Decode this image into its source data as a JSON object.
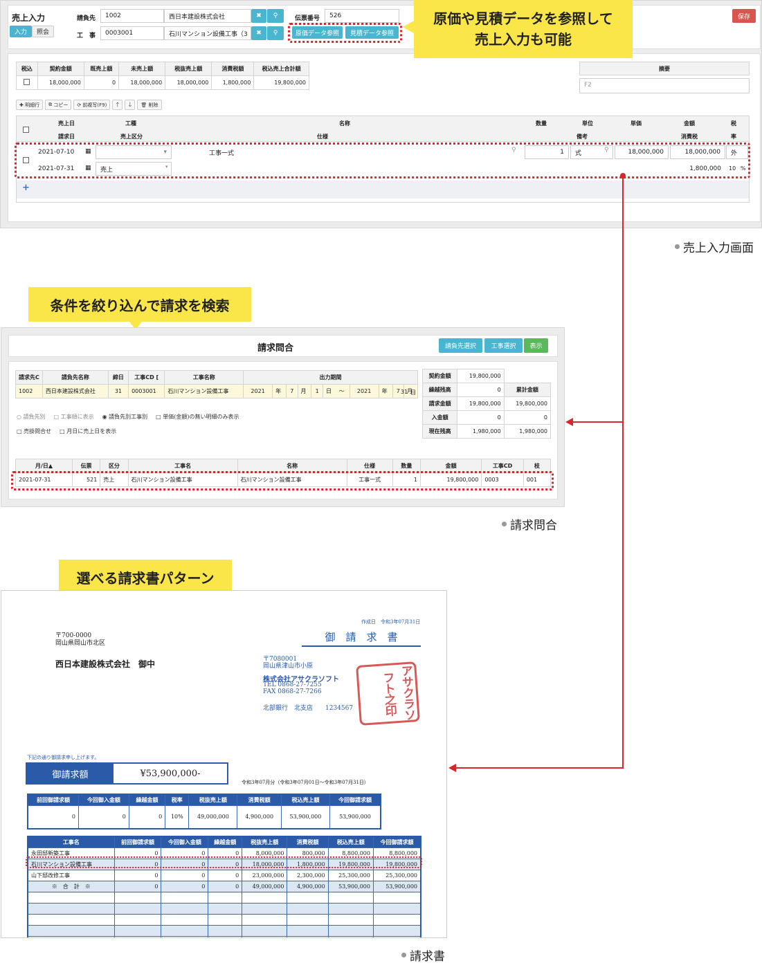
{
  "colors": {
    "callout": "#fbe64a",
    "red": "#d8262d",
    "teal": "#4ab5cf",
    "green": "#5cb85c",
    "save": "#d9534f",
    "blue": "#2a5aa8"
  },
  "sales": {
    "title": "売上入力",
    "tab_input": "入力",
    "tab_ref": "照会",
    "customer_label": "請負先",
    "customer_code": "1002",
    "customer_name": "西日本建設株式会社",
    "work_label": "工　事",
    "work_code": "0003001",
    "work_name": "石川マンション設備工事（3",
    "slip_label": "伝票番号",
    "slip_no": "526",
    "btn_cost": "原価データ参照",
    "btn_estimate": "見積データ参照",
    "save": "保存",
    "summary_headers": [
      "税込",
      "契約金額",
      "既売上額",
      "未売上額",
      "税抜売上額",
      "消費税額",
      "税込売上合計額"
    ],
    "summary_values": [
      "18,000,000",
      "0",
      "18,000,000",
      "18,000,000",
      "1,800,000",
      "19,800,000"
    ],
    "memo_label": "摘要",
    "memo_placeholder": "F2",
    "toolbar": [
      "明細行",
      "コピー",
      "前複写(F9)",
      "削除"
    ],
    "grid_h1": [
      "売上日",
      "工種",
      "名称",
      "数量",
      "単位",
      "単価",
      "金額",
      "税"
    ],
    "grid_h2": [
      "請求日",
      "売上区分",
      "仕様",
      "備考",
      "消費税",
      "率"
    ],
    "row1": {
      "date": "2021-07-10",
      "name": "工事一式",
      "qty": "1",
      "unit": "式",
      "price": "18,000,000",
      "amount": "18,000,000",
      "tax": "外"
    },
    "row2": {
      "date": "2021-07-31",
      "kubun": "売上",
      "tax_amount": "1,800,000",
      "rate": "10",
      "pct": "%"
    },
    "add": "+"
  },
  "callout1": {
    "line1": "原価や見積データを参照して",
    "line2": "売上入力も可能"
  },
  "caption1": "売上入力画面",
  "callout2": "条件を絞り込んで請求を検索",
  "inquiry": {
    "title": "請求問合",
    "btn_customer": "請負先選択",
    "btn_work": "工事選択",
    "btn_show": "表示",
    "cond_headers": [
      "請求先C",
      "請負先名称",
      "締日",
      "工事CD [",
      "工事名称",
      "出力期間"
    ],
    "cond_values": {
      "code": "1002",
      "name": "西日本建設株式会社",
      "close": "31",
      "work_cd": "0003001",
      "work_name": "石川マンション設備工事",
      "y1": "2021",
      "m1": "7",
      "d1": "1",
      "y2": "2021",
      "m2": "7",
      "d2": "31",
      "year": "年",
      "month": "月",
      "day": "日",
      "tilde": "〜"
    },
    "options": [
      "請負先別",
      "工事順に表示",
      "請負先別工事別",
      "単価(金額)の無い明細のみ表示",
      "売掛問合せ",
      "月日に売上日を表示"
    ],
    "side": {
      "contract_label": "契約金額",
      "contract": "19,800,000",
      "carry_label": "繰越残高",
      "carry": "0",
      "cum_label": "累計金額",
      "bill_label": "請求金額",
      "bill": "19,800,000",
      "bill_cum": "19,800,000",
      "recv_label": "入金額",
      "recv": "0",
      "recv_cum": "0",
      "bal_label": "現在残高",
      "bal": "1,980,000",
      "bal_cum": "1,980,000"
    },
    "list_headers": [
      "月/日▲",
      "伝票",
      "区分",
      "工事名",
      "名称",
      "仕様",
      "数量",
      "金額",
      "工事CD",
      "枝"
    ],
    "list_row": [
      "2021-07-31",
      "521",
      "売上",
      "石川マンション設備工事",
      "石川マンション設備工事",
      "工事一式",
      "1",
      "19,800,000",
      "0003",
      "001"
    ]
  },
  "caption2": "請求問合",
  "callout3": "選べる請求書パターン",
  "invoice": {
    "created": "作成日　令和3年07月31日",
    "title": "御　請　求　書",
    "to_zip": "〒700-0000",
    "to_addr": "岡山県岡山市北区",
    "to_name": "西日本建設株式会社　御中",
    "from_zip": "〒7080001",
    "from_addr": "岡山県津山市小原",
    "from_company": "株式会社アサクラソフト",
    "tel": "TEL 0868-27-7255",
    "fax": "FAX 0868-27-7266",
    "bank": "北部銀行　北支店　　1234567",
    "stamp": "アサクラソフト之印",
    "lead": "下記の通り御請求申し上げます。",
    "amount_label": "御請求額",
    "amount": "¥53,900,000-",
    "period": "令和3年07月分（令和3年07月01日〜令和3年07月31日）",
    "sum_headers": [
      "前回御請求額",
      "今回御入金額",
      "繰越金額",
      "税率",
      "税抜売上額",
      "消費税額",
      "税込売上額",
      "今回御請求額"
    ],
    "sum_values": [
      "0",
      "0",
      "0",
      "10%",
      "49,000,000",
      "4,900,000",
      "53,900,000",
      "53,900,000"
    ],
    "det_headers": [
      "工事名",
      "前回御請求額",
      "今回御入金額",
      "繰越金額",
      "税抜売上額",
      "消費税額",
      "税込売上額",
      "今回御請求額"
    ],
    "det_rows": [
      [
        "永田邸新築工事",
        "0",
        "0",
        "0",
        "8,000,000",
        "800,000",
        "8,800,000",
        "8,800,000"
      ],
      [
        "石川マンション設備工事",
        "0",
        "0",
        "0",
        "18,000,000",
        "1,800,000",
        "19,800,000",
        "19,800,000"
      ],
      [
        "山下邸改修工事",
        "0",
        "0",
        "0",
        "23,000,000",
        "2,300,000",
        "25,300,000",
        "25,300,000"
      ],
      [
        "※　合　計　※",
        "0",
        "0",
        "0",
        "49,000,000",
        "4,900,000",
        "53,900,000",
        "53,900,000"
      ]
    ]
  },
  "caption3": "請求書"
}
